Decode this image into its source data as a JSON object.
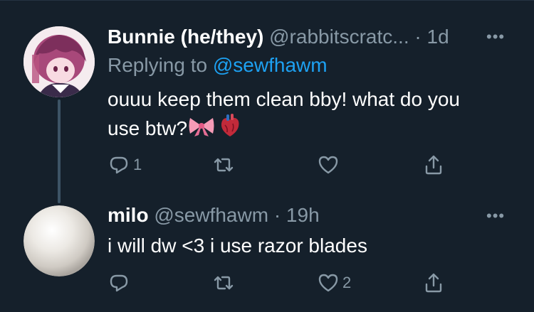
{
  "tweets": [
    {
      "display_name": "Bunnie (he/they)",
      "handle": "@rabbitscratc...",
      "separator": "·",
      "time": "1d",
      "more": "•••",
      "replying_prefix": "Replying to ",
      "replying_to": "@sewfhawm",
      "text_line1": "ouuu keep them clean bby! what do you",
      "text_line2": "use btw?",
      "emoji_icons": [
        "ribbon-icon",
        "anatomical-heart-icon"
      ],
      "actions": {
        "reply_count": "1",
        "retweet_count": "",
        "like_count": ""
      }
    },
    {
      "display_name": "milo",
      "handle": "@sewfhawm",
      "separator": "·",
      "time": "19h",
      "more": "•••",
      "text_line1": "i will dw <3 i use razor blades",
      "actions": {
        "reply_count": "",
        "retweet_count": "",
        "like_count": "2"
      }
    }
  ],
  "colors": {
    "background": "#15202b",
    "text": "#ffffff",
    "secondary": "#8899a6",
    "link": "#1da1f2",
    "thread_line": "#3d5466"
  }
}
